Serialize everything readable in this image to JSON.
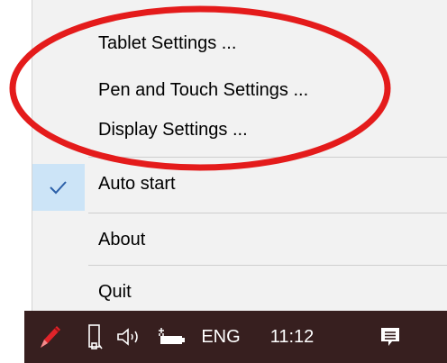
{
  "menu": {
    "items": [
      {
        "label": "Tablet Settings ..."
      },
      {
        "label": "Pen and Touch Settings ..."
      },
      {
        "label": "Display Settings ..."
      },
      {
        "label": "Auto start",
        "checked": true
      },
      {
        "label": "About"
      },
      {
        "label": "Quit"
      }
    ]
  },
  "annotation": {
    "color": "#e41b1b"
  },
  "taskbar": {
    "language": "ENG",
    "time": "11:12",
    "icons": [
      "pen-tablet-icon",
      "usb-drive-icon",
      "speaker-icon",
      "battery-icon",
      "notification-icon"
    ]
  },
  "colors": {
    "menu_bg": "#f2f2f2",
    "check_bg": "#cce4f7",
    "taskbar_bg": "#371f1f"
  }
}
